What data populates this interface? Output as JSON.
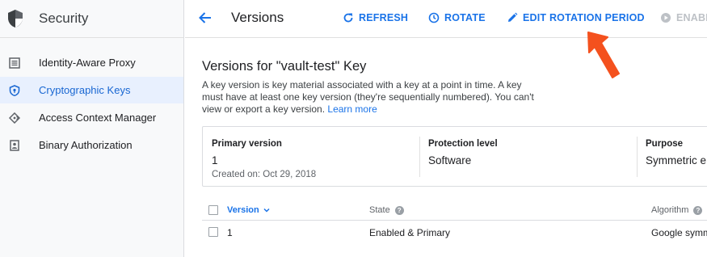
{
  "sidebar": {
    "title": "Security",
    "items": [
      {
        "label": "Identity-Aware Proxy",
        "icon": "list-icon"
      },
      {
        "label": "Cryptographic Keys",
        "icon": "shield-key-icon",
        "active": true
      },
      {
        "label": "Access Context Manager",
        "icon": "diamond-icon"
      },
      {
        "label": "Binary Authorization",
        "icon": "badge-icon"
      }
    ]
  },
  "topbar": {
    "title": "Versions",
    "buttons": {
      "refresh": "REFRESH",
      "rotate": "ROTATE",
      "edit_rotation": "EDIT ROTATION PERIOD",
      "enable": "ENABL"
    }
  },
  "main": {
    "heading": "Versions for \"vault-test\" Key",
    "description": "A key version is key material associated with a key at a point in time. A key must have at least one key version (they're sequentially numbered). You can't view or export a key version.",
    "learn_more": "Learn more",
    "summary": {
      "primary_label": "Primary version",
      "primary_value": "1",
      "created": "Created on: Oct 29, 2018",
      "protection_label": "Protection level",
      "protection_value": "Software",
      "purpose_label": "Purpose",
      "purpose_value": "Symmetric e"
    },
    "table": {
      "columns": {
        "version": "Version",
        "state": "State",
        "algorithm": "Algorithm"
      },
      "rows": [
        {
          "version": "1",
          "state": "Enabled & Primary",
          "algorithm": "Google symm"
        }
      ]
    }
  },
  "colors": {
    "accent": "#1a73e8",
    "active_bg": "#e8f0fe",
    "annotation_arrow": "#f4511e"
  }
}
